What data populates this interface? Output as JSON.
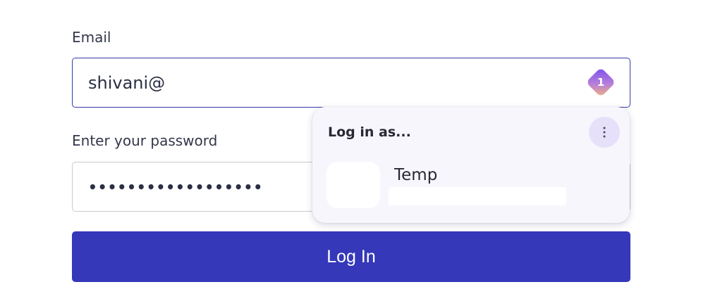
{
  "email": {
    "label": "Email",
    "value": "shivani@",
    "autofill_badge_count": "1"
  },
  "password": {
    "label": "Enter your password",
    "masked_value": "••••••••••••••••••"
  },
  "login_button": {
    "label": "Log In"
  },
  "autofill_popup": {
    "title": "Log in as...",
    "more_icon": "more-vertical-icon",
    "accounts": [
      {
        "name": "Temp"
      }
    ]
  },
  "colors": {
    "primary": "#3538b9",
    "focus_border": "#3539a8",
    "popup_background": "#f8f6fd",
    "more_button_background": "#e6e0fa",
    "badge_gradient_start": "#7b4ff0",
    "badge_gradient_end": "#f3b47c"
  }
}
